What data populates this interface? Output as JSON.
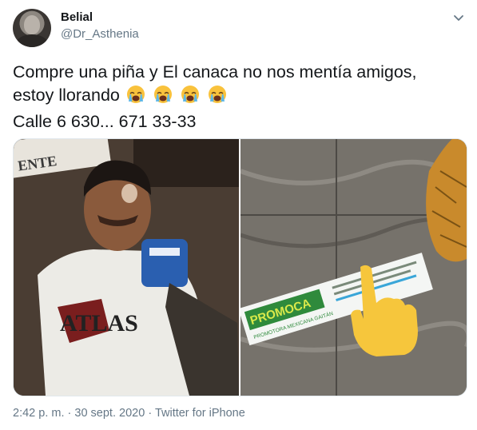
{
  "author": {
    "display_name": "Belial",
    "handle": "@Dr_Asthenia"
  },
  "tweet": {
    "line1": "Compre una piña y El canaca no nos mentía amigos,",
    "line2": "estoy llorando",
    "line3": "Calle 6 630... 671 33-33",
    "emoji": [
      "crying-face",
      "crying-face",
      "crying-face",
      "crying-face"
    ]
  },
  "media": {
    "left_image_texts": [
      "ENTE",
      "ATLAS"
    ],
    "right_image_texts": [
      "PROMOCA",
      "PROMOTORA MEXICANA GAITÁN"
    ]
  },
  "meta": {
    "time": "2:42 p. m.",
    "separator1": "·",
    "date": "30 sept. 2020",
    "separator2": "·",
    "source": "Twitter for iPhone"
  },
  "colors": {
    "text": "#14171a",
    "secondary": "#657786",
    "border": "#e1e8ed"
  }
}
